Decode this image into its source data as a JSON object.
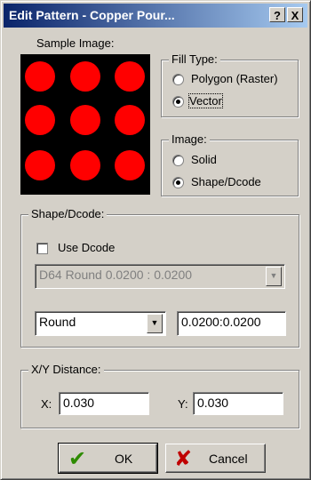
{
  "window": {
    "title": "Edit Pattern - Copper Pour...",
    "help_label": "?",
    "close_label": "X"
  },
  "sample": {
    "label": "Sample Image:",
    "background": "#000000",
    "dot_color": "#ff0000",
    "dots_per_row": 3,
    "dot_rows": 3
  },
  "fill_type": {
    "title": "Fill Type:",
    "options": [
      {
        "label": "Polygon (Raster)",
        "selected": false
      },
      {
        "label": "Vector",
        "selected": true
      }
    ]
  },
  "image": {
    "title": "Image:",
    "options": [
      {
        "label": "Solid",
        "selected": false
      },
      {
        "label": "Shape/Dcode",
        "selected": true
      }
    ]
  },
  "shape_dcode": {
    "title": "Shape/Dcode:",
    "use_dcode_label": "Use Dcode",
    "use_dcode_checked": false,
    "dcode_select_value": "D64   Round   0.0200 : 0.0200",
    "shape_select_value": "Round",
    "size_value": "0.0200:0.0200"
  },
  "xy_distance": {
    "title": "X/Y Distance:",
    "x_label": "X:",
    "x_value": "0.030",
    "y_label": "Y:",
    "y_value": "0.030"
  },
  "buttons": {
    "ok_label": "OK",
    "cancel_label": "Cancel",
    "ok_icon": "check-icon",
    "ok_icon_color": "#2e8b00",
    "cancel_icon": "x-icon",
    "cancel_icon_color": "#c00000"
  }
}
